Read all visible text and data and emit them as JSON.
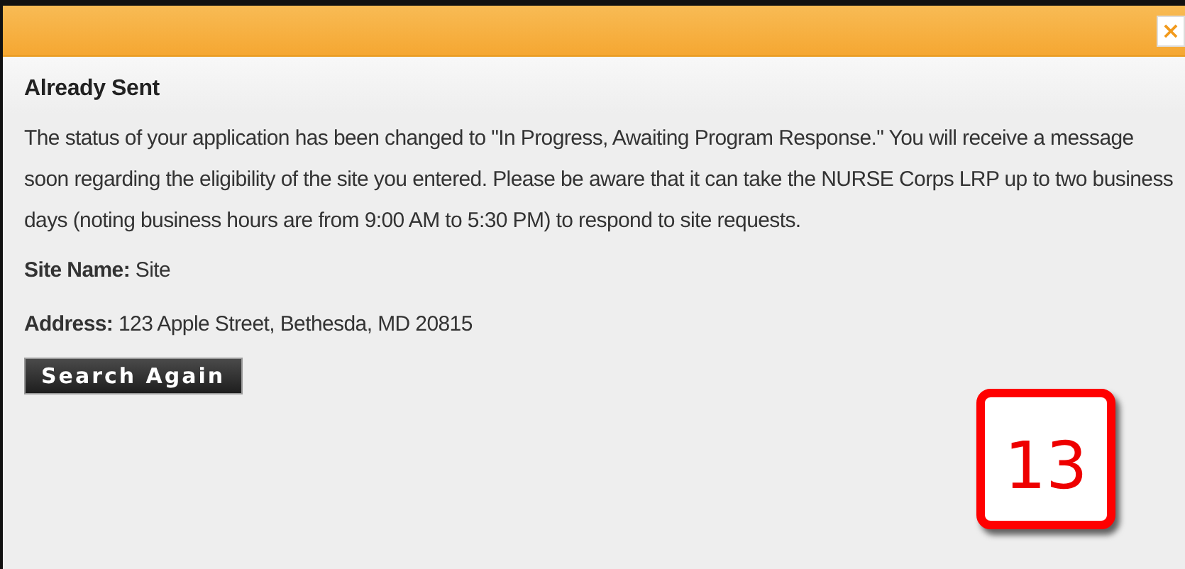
{
  "dialog": {
    "close_label": "×",
    "heading": "Already Sent",
    "message": "The status of your application has been changed to \"In Progress, Awaiting Program Response.\" You will receive a message soon regarding the eligibility of the site you entered. Please be aware that it can take the NURSE Corps LRP up to two business days (noting business hours are from 9:00 AM to 5:30 PM) to respond to site requests.",
    "fields": [
      "**Site Name:** Site",
      "**Address:** 123 Apple Street, Bethesda, MD 20815"
    ],
    "button": "Search Again"
  },
  "callout": {
    "number": "13"
  }
}
